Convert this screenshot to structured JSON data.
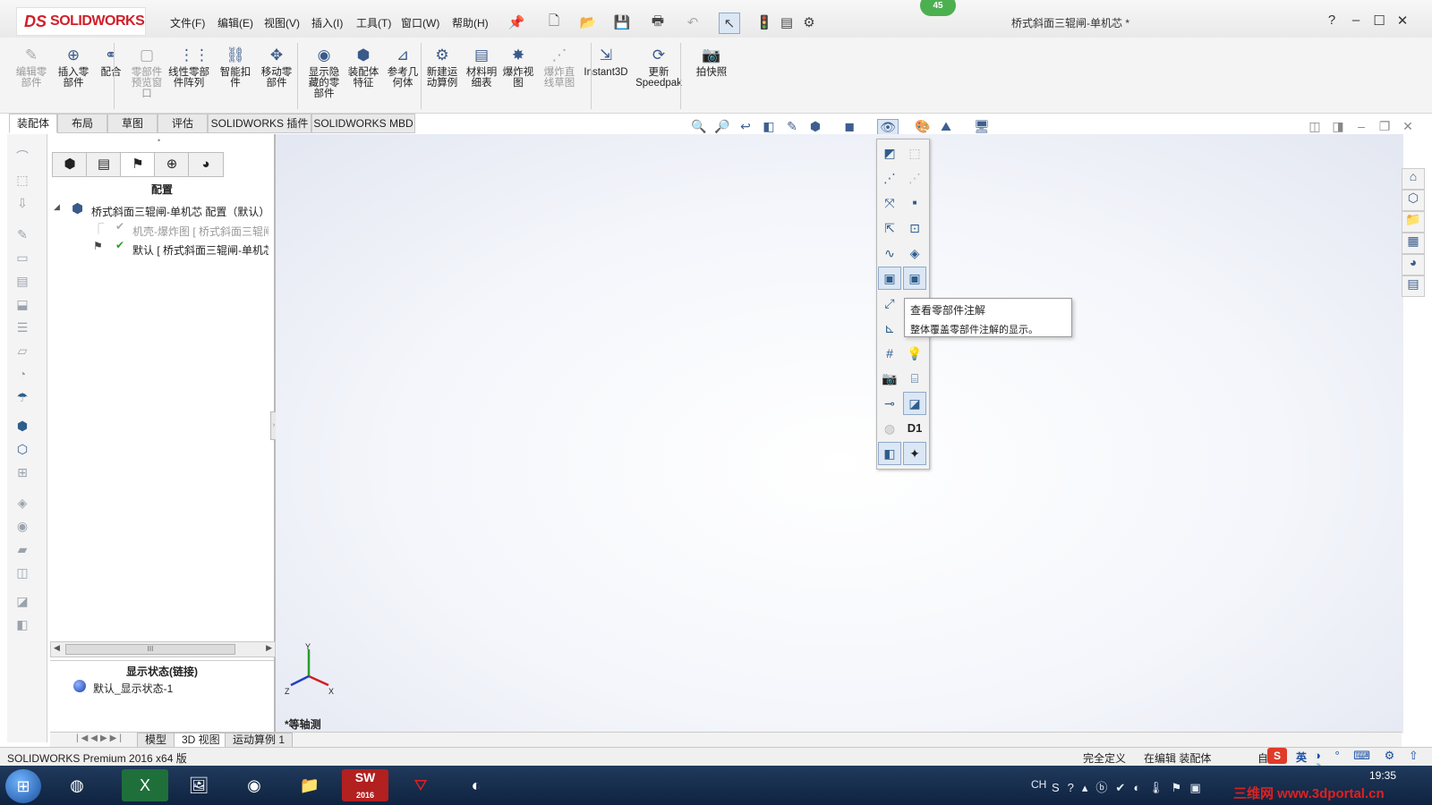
{
  "app": {
    "logo_ds": "DS",
    "logo_text": "SOLIDWORKS",
    "document_title": "桥式斜面三辊闸-单机芯 *",
    "badge": "45"
  },
  "menu": [
    "文件(F)",
    "编辑(E)",
    "视图(V)",
    "插入(I)",
    "工具(T)",
    "窗口(W)",
    "帮助(H)"
  ],
  "ribbon": {
    "buttons": [
      {
        "label": "编辑零\n部件",
        "icon": "edit-component-icon",
        "enabled": false
      },
      {
        "label": "插入零\n部件",
        "icon": "insert-component-icon",
        "enabled": true
      },
      {
        "label": "配合",
        "icon": "mate-icon",
        "enabled": true
      },
      {
        "label": "零部件\n预览窗\n口",
        "icon": "component-preview-icon",
        "enabled": false
      },
      {
        "label": "线性零部\n件阵列",
        "icon": "linear-pattern-icon",
        "enabled": true
      },
      {
        "label": "智能扣\n件",
        "icon": "smart-fastener-icon",
        "enabled": true
      },
      {
        "label": "移动零\n部件",
        "icon": "move-component-icon",
        "enabled": true
      },
      {
        "label": "显示隐\n藏的零\n部件",
        "icon": "show-hidden-icon",
        "enabled": true
      },
      {
        "label": "装配体\n特征",
        "icon": "assembly-feature-icon",
        "enabled": true
      },
      {
        "label": "参考几\n何体",
        "icon": "reference-geometry-icon",
        "enabled": true
      },
      {
        "label": "新建运\n动算例",
        "icon": "motion-study-icon",
        "enabled": true
      },
      {
        "label": "材料明\n细表",
        "icon": "bom-icon",
        "enabled": true
      },
      {
        "label": "爆炸视\n图",
        "icon": "exploded-view-icon",
        "enabled": true
      },
      {
        "label": "爆炸直\n线草图",
        "icon": "explode-line-icon",
        "enabled": false
      },
      {
        "label": "Instant3D",
        "icon": "instant3d-icon",
        "enabled": true
      },
      {
        "label": "更新\nSpeedpak",
        "icon": "speedpak-icon",
        "enabled": true
      },
      {
        "label": "拍快照",
        "icon": "camera-icon",
        "enabled": true
      }
    ]
  },
  "tabs": [
    "装配体",
    "布局",
    "草图",
    "评估",
    "SOLIDWORKS 插件",
    "SOLIDWORKS MBD"
  ],
  "feature_manager": {
    "section_title": "配置",
    "tree": [
      {
        "label": "桥式斜面三辊闸-单机芯 配置（默认）",
        "level": 0
      },
      {
        "label": "机壳-爆炸图 [ 桥式斜面三辊闸",
        "level": 1,
        "dim": true
      },
      {
        "label": "默认 [ 桥式斜面三辊闸-单机芯",
        "level": 1,
        "active": true
      }
    ],
    "display_state_title": "显示状态(链接)",
    "display_state_item": "默认_显示状态-1",
    "scroll_thumb": "III"
  },
  "flyout": {
    "tooltip_title": "查看零部件注解",
    "tooltip_desc": "整体覆盖零部件注解的显示。",
    "d1_label": "D1"
  },
  "viewport": {
    "view_name": "*等轴测",
    "triad_x": "X",
    "triad_y": "Y",
    "triad_z": "Z"
  },
  "bottom_tabs": [
    "模型",
    "3D 视图",
    "运动算例 1"
  ],
  "status": {
    "product": "SOLIDWORKS Premium 2016 x64 版",
    "definition": "完全定义",
    "editing": "在编辑 装配体",
    "custom": "自"
  },
  "taskbar": {
    "apps": [
      "start-icon",
      "360-icon",
      "excel-icon",
      "paint-icon",
      "chrome-icon",
      "explorer-icon",
      "solidworks-icon",
      "acrobat-icon",
      "browser-icon"
    ],
    "sw_badge": "2016",
    "lang": "CH",
    "ime": "英",
    "clock": "19:35",
    "watermark": "三维网 www.3dportal.cn"
  },
  "colors": {
    "brand_red": "#d0202a",
    "accent_blue": "#2f5d8c",
    "selection_blue": "#dbe7f5",
    "taskbar": "#0f2340"
  }
}
